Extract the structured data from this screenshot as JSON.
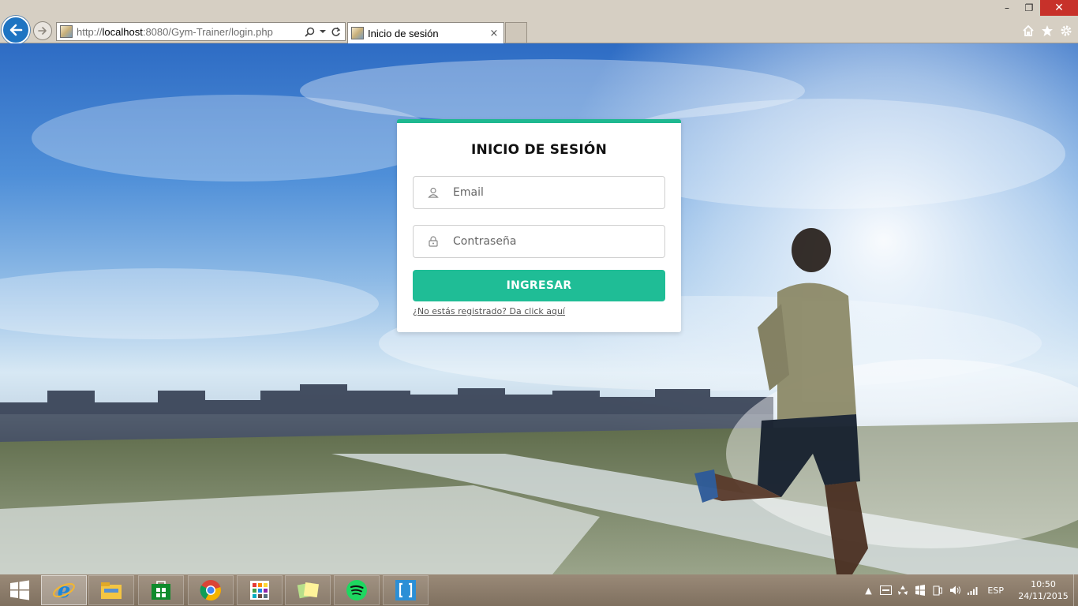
{
  "browser": {
    "url_prefix": "http://",
    "url_host": "localhost",
    "url_rest": ":8080/Gym-Trainer/login.php",
    "tab_title": "Inicio de sesión",
    "tab_close": "×",
    "window_controls": {
      "minimize": "–",
      "restore": "❐",
      "close": "✕"
    },
    "tool_icons": [
      "home-icon",
      "favorites-star-icon",
      "settings-gear-icon"
    ]
  },
  "login": {
    "title": "INICIO DE SESIÓN",
    "email_placeholder": "Email",
    "password_placeholder": "Contraseña",
    "submit_label": "INGRESAR",
    "register_link": "¿No estás registrado? Da click aquí",
    "accent_color": "#1fbd96"
  },
  "taskbar": {
    "apps": [
      "internet-explorer",
      "file-explorer",
      "windows-store",
      "chrome",
      "apps-grid",
      "sticky-notes",
      "spotify",
      "brackets"
    ],
    "language": "ESP",
    "time": "10:50",
    "date": "24/11/2015"
  }
}
